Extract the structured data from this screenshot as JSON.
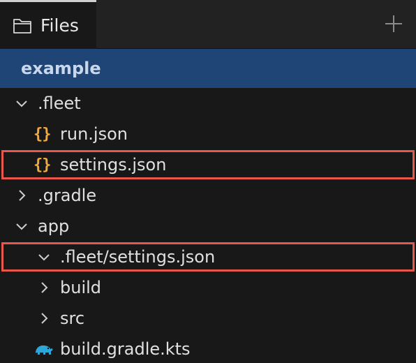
{
  "header": {
    "tab_label": "Files",
    "tab_icon": "folder-icon",
    "add_icon": "plus-icon"
  },
  "project": {
    "name": "example"
  },
  "tree": {
    "fleet_folder": {
      "label": ".fleet",
      "state": "expanded"
    },
    "run_json": {
      "label": "run.json",
      "icon": "{}"
    },
    "settings_json": {
      "label": "settings.json",
      "icon": "{}",
      "highlighted": true
    },
    "gradle_folder": {
      "label": ".gradle",
      "state": "collapsed"
    },
    "app_folder": {
      "label": "app",
      "state": "expanded"
    },
    "app_fleet_settings": {
      "label": ".fleet/settings.json",
      "state": "expanded",
      "highlighted": true
    },
    "build_folder": {
      "label": "build",
      "state": "collapsed"
    },
    "src_folder": {
      "label": "src",
      "state": "collapsed"
    },
    "build_gradle": {
      "label": "build.gradle.kts",
      "icon": "gradle-elephant-icon"
    }
  },
  "colors": {
    "background": "#181818",
    "selection": "#1f4476",
    "json_icon": "#f3a93b",
    "gradle_icon": "#2ea7d8",
    "highlight_border": "#e8574c"
  }
}
